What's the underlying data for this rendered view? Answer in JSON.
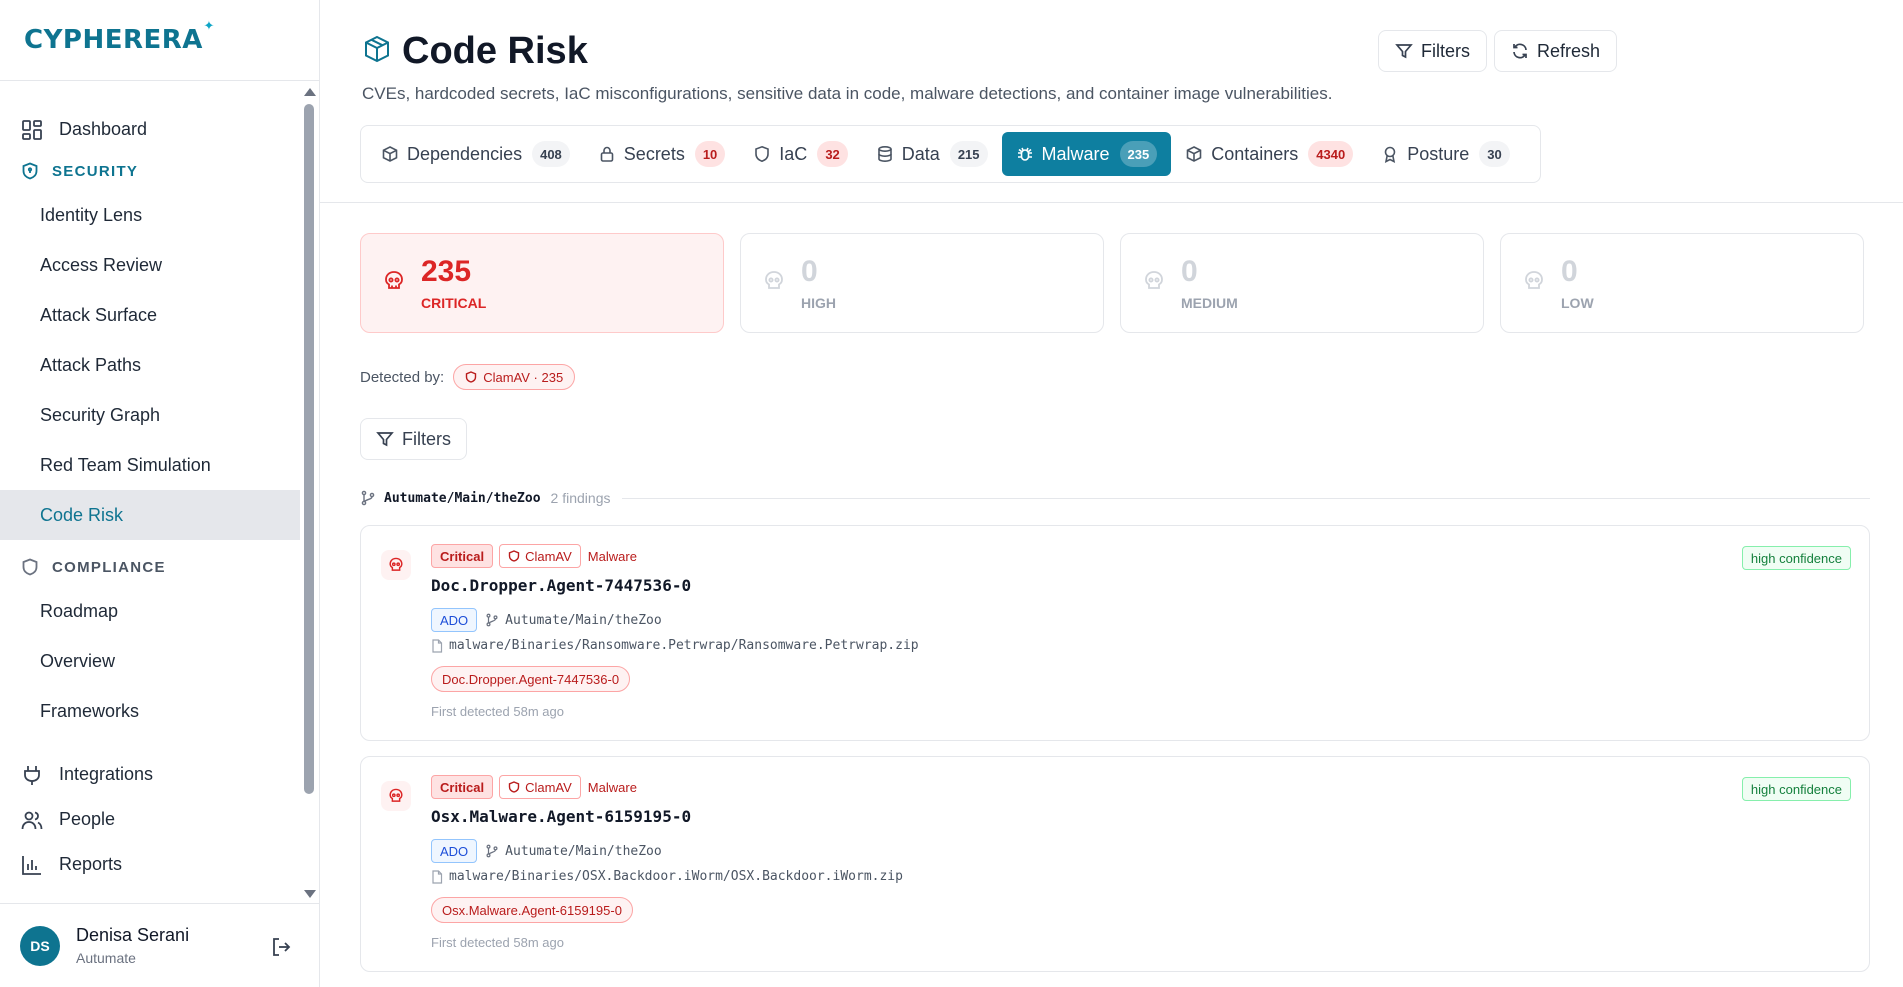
{
  "brand": {
    "name": "CYPHERERA",
    "star": "✦"
  },
  "sidebar": {
    "dashboard": "Dashboard",
    "security": {
      "label": "SECURITY",
      "items": [
        "Identity Lens",
        "Access Review",
        "Attack Surface",
        "Attack Paths",
        "Security Graph",
        "Red Team Simulation",
        "Code Risk"
      ],
      "active": "Code Risk"
    },
    "compliance": {
      "label": "COMPLIANCE",
      "items": [
        "Roadmap",
        "Overview",
        "Frameworks"
      ]
    },
    "bottom_items": [
      "Integrations",
      "People",
      "Reports"
    ],
    "user": {
      "initials": "DS",
      "name": "Denisa Serani",
      "org": "Autumate"
    }
  },
  "header": {
    "title": "Code Risk",
    "subtitle": "CVEs, hardcoded secrets, IaC misconfigurations, sensitive data in code, malware detections, and container image vulnerabilities.",
    "filters_label": "Filters",
    "refresh_label": "Refresh"
  },
  "tabs": [
    {
      "label": "Dependencies",
      "count": "408",
      "icon": "package-icon"
    },
    {
      "label": "Secrets",
      "count": "10",
      "icon": "lock-icon"
    },
    {
      "label": "IaC",
      "count": "32",
      "icon": "shield-icon"
    },
    {
      "label": "Data",
      "count": "215",
      "icon": "database-icon"
    },
    {
      "label": "Malware",
      "count": "235",
      "icon": "bug-icon"
    },
    {
      "label": "Containers",
      "count": "4340",
      "icon": "box-icon"
    },
    {
      "label": "Posture",
      "count": "30",
      "icon": "award-icon"
    }
  ],
  "active_tab": "Malware",
  "severity_cards": [
    {
      "count": "235",
      "label": "CRITICAL"
    },
    {
      "count": "0",
      "label": "HIGH"
    },
    {
      "count": "0",
      "label": "MEDIUM"
    },
    {
      "count": "0",
      "label": "LOW"
    }
  ],
  "detected_by": {
    "label": "Detected by:",
    "pill": "ClamAV · 235"
  },
  "filters_button": "Filters",
  "repo_group": {
    "name": "Autumate/Main/theZoo",
    "count": "2 findings"
  },
  "findings": [
    {
      "severity": "Critical",
      "scanner": "ClamAV",
      "type": "Malware",
      "name": "Doc.Dropper.Agent-7447536-0",
      "source": "ADO",
      "repo": "Autumate/Main/theZoo",
      "path": "malware/Binaries/Ransomware.Petrwrap/Ransomware.Petrwrap.zip",
      "signature": "Doc.Dropper.Agent-7447536-0",
      "first_detected": "First detected 58m ago",
      "confidence": "high confidence"
    },
    {
      "severity": "Critical",
      "scanner": "ClamAV",
      "type": "Malware",
      "name": "Osx.Malware.Agent-6159195-0",
      "source": "ADO",
      "repo": "Autumate/Main/theZoo",
      "path": "malware/Binaries/OSX.Backdoor.iWorm/OSX.Backdoor.iWorm.zip",
      "signature": "Osx.Malware.Agent-6159195-0",
      "first_detected": "First detected 58m ago",
      "confidence": "high confidence"
    }
  ],
  "colors": {
    "accent": "#0e7490",
    "active_tab": "#0e7fa0",
    "critical": "#dc2626"
  }
}
